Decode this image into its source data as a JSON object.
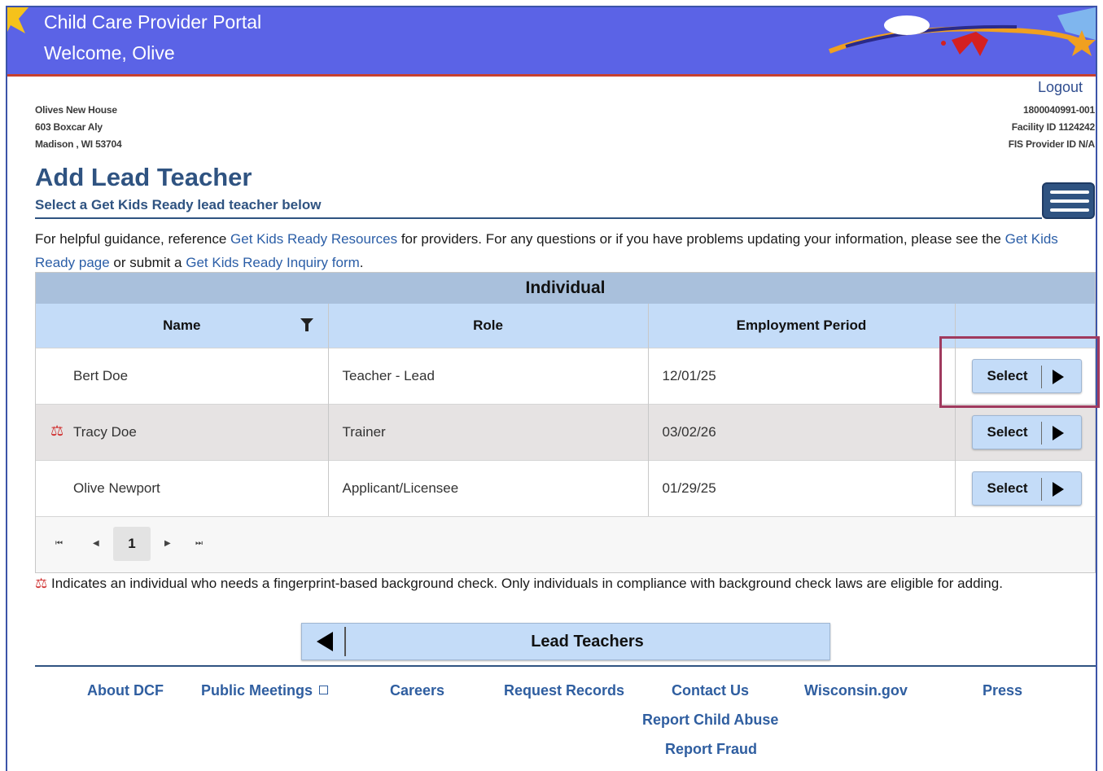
{
  "header": {
    "title": "Child Care Provider Portal",
    "welcome": "Welcome, Olive",
    "logout": "Logout"
  },
  "provider": {
    "name": "Olives New House",
    "street": "603 Boxcar Aly",
    "city": "Madison , WI 53704",
    "provider_number": "1800040991-001",
    "facility_id": "Facility ID 1124242",
    "fis_id": "FIS Provider ID N/A"
  },
  "page": {
    "title": "Add Lead Teacher",
    "subtitle": "Select a Get Kids Ready lead teacher below",
    "intro_1": "For helpful guidance, reference ",
    "link_resources": "Get Kids Ready Resources",
    "intro_2": " for providers. For any questions or if you have problems updating your information, please see the ",
    "link_page": "Get Kids Ready page",
    "intro_3": " or submit a ",
    "link_form": "Get Kids Ready Inquiry form",
    "intro_4": "."
  },
  "grid": {
    "caption": "Individual",
    "columns": [
      "Name",
      "Role",
      "Employment Period",
      ""
    ],
    "rows": [
      {
        "name": "Bert Doe",
        "role": "Teacher - Lead",
        "period": "12/01/25",
        "needs_fingerprint": false,
        "action": "Select"
      },
      {
        "name": "Tracy Doe",
        "role": "Trainer",
        "period": "03/02/26",
        "needs_fingerprint": true,
        "action": "Select"
      },
      {
        "name": "Olive Newport",
        "role": "Applicant/Licensee",
        "period": "01/29/25",
        "needs_fingerprint": false,
        "action": "Select"
      }
    ],
    "pager": {
      "current_page": "1"
    }
  },
  "note": {
    "icon": "⚖",
    "text": " Indicates an individual who needs a fingerprint-based background check. Only individuals in compliance with background check laws are eligible for adding."
  },
  "back_button": {
    "label": "Lead Teachers"
  },
  "footer": {
    "links": [
      "About DCF",
      "Public Meetings",
      "Careers",
      "Request Records",
      "Contact Us",
      "Wisconsin.gov",
      "Press",
      "Report Child Abuse",
      "Report Fraud"
    ]
  },
  "colors": {
    "banner": "#5b63e6",
    "brand_blue": "#2f5381",
    "header_row": "#c4dcf8",
    "caption_bar": "#a9c0dc",
    "highlight_border": "#a03a5e"
  }
}
